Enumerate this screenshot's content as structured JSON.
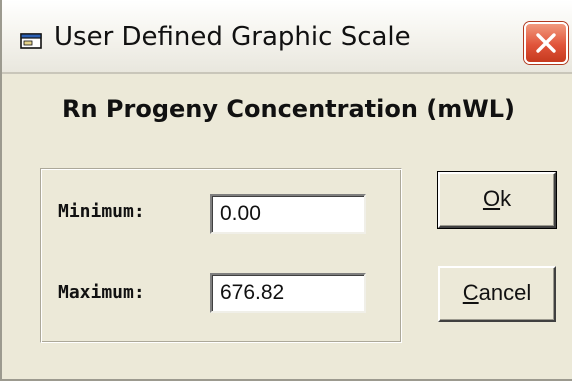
{
  "window": {
    "title": "User Defined Graphic Scale",
    "icon": "window-app-icon",
    "close_icon": "close-icon"
  },
  "heading": "Rn Progeny Concentration (mWL)",
  "fields": {
    "minimum": {
      "label": "Minimum:",
      "value": "0.00"
    },
    "maximum": {
      "label": "Maximum:",
      "value": "676.82"
    }
  },
  "buttons": {
    "ok": {
      "hotkey": "O",
      "rest": "k"
    },
    "cancel": {
      "hotkey": "C",
      "rest": "ancel"
    }
  },
  "colors": {
    "dialog_background": "#ece9d8",
    "close_button": "#e1543a"
  }
}
